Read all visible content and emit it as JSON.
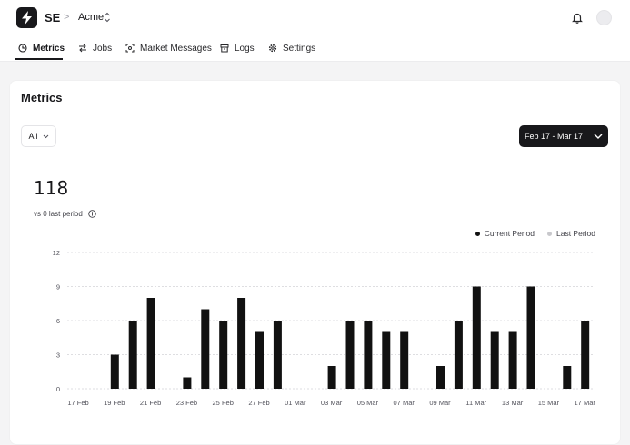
{
  "header": {
    "brand": "SE",
    "separator": ">",
    "org": "Acme"
  },
  "tabs": [
    {
      "label": "Metrics",
      "icon": "clock-icon",
      "active": true
    },
    {
      "label": "Jobs",
      "icon": "arrows-icon",
      "active": false
    },
    {
      "label": "Market Messages",
      "icon": "scan-icon",
      "active": false
    },
    {
      "label": "Logs",
      "icon": "archive-icon",
      "active": false
    },
    {
      "label": "Settings",
      "icon": "gear-icon",
      "active": false
    }
  ],
  "page": {
    "title": "Metrics",
    "filter_value": "All",
    "date_range": "Feb 17 - Mar 17",
    "total": "118",
    "comparison": "vs 0 last period"
  },
  "colors": {
    "current": "#111111",
    "last": "#c8c8cc",
    "accent": "#18181b"
  },
  "chart_data": {
    "type": "bar",
    "title": "",
    "xlabel": "",
    "ylabel": "",
    "ylim": [
      0,
      12
    ],
    "yticks": [
      "0",
      "3",
      "6",
      "9",
      "12"
    ],
    "grid": true,
    "legend_position": "top-right",
    "categories": [
      "17 Feb",
      "18 Feb",
      "19 Feb",
      "20 Feb",
      "21 Feb",
      "22 Feb",
      "23 Feb",
      "24 Feb",
      "25 Feb",
      "26 Feb",
      "27 Feb",
      "28 Feb",
      "01 Mar",
      "02 Mar",
      "03 Mar",
      "04 Mar",
      "05 Mar",
      "06 Mar",
      "07 Mar",
      "08 Mar",
      "09 Mar",
      "10 Mar",
      "11 Mar",
      "12 Mar",
      "13 Mar",
      "14 Mar",
      "15 Mar",
      "16 Mar",
      "17 Mar"
    ],
    "tick_labels": [
      "17 Feb",
      "19 Feb",
      "21 Feb",
      "23 Feb",
      "25 Feb",
      "27 Feb",
      "01 Mar",
      "03 Mar",
      "05 Mar",
      "07 Mar",
      "09 Mar",
      "11 Mar",
      "13 Mar",
      "15 Mar",
      "17 Mar"
    ],
    "series": [
      {
        "name": "Current Period",
        "values": [
          0,
          0,
          3,
          6,
          8,
          0,
          1,
          7,
          6,
          8,
          5,
          6,
          0,
          0,
          2,
          6,
          6,
          5,
          5,
          0,
          2,
          6,
          9,
          5,
          5,
          9,
          0,
          2,
          6
        ]
      },
      {
        "name": "Last Period",
        "values": [
          0,
          0,
          0,
          0,
          0,
          0,
          0,
          0,
          0,
          0,
          0,
          0,
          0,
          0,
          0,
          0,
          0,
          0,
          0,
          0,
          0,
          0,
          0,
          0,
          0,
          0,
          0,
          0,
          0
        ]
      }
    ]
  }
}
